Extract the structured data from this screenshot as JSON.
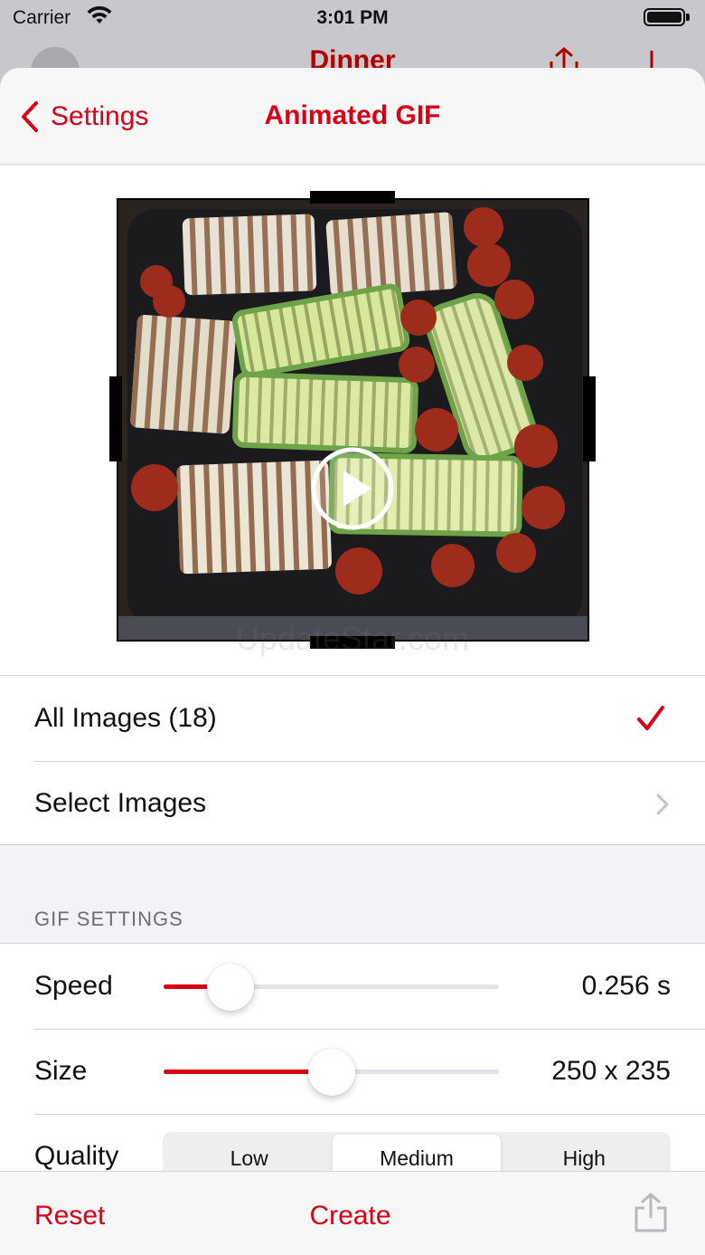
{
  "status_bar": {
    "carrier": "Carrier",
    "time": "3:01 PM"
  },
  "background_nav": {
    "title": "Dinner"
  },
  "navbar": {
    "back_label": "Settings",
    "title": "Animated GIF"
  },
  "preview": {
    "watermark": "UpdateStar.com",
    "play_icon": "play-icon"
  },
  "image_selection": [
    {
      "label": "All Images (18)",
      "accessory": "checkmark-icon",
      "selected": true
    },
    {
      "label": "Select Images",
      "accessory": "chevron-right-icon",
      "selected": false
    }
  ],
  "gif_settings": {
    "header": "GIF SETTINGS",
    "speed": {
      "label": "Speed",
      "value": "0.256 s",
      "level": 0.2
    },
    "size": {
      "label": "Size",
      "value": "250 x 235",
      "level": 0.5
    },
    "quality": {
      "label": "Quality",
      "options": [
        "Low",
        "Medium",
        "High"
      ],
      "selected": "Medium"
    }
  },
  "toolbar": {
    "reset_label": "Reset",
    "create_label": "Create",
    "share_icon": "share-icon"
  },
  "colors": {
    "accent": "#d70015",
    "background": "#f2f2f7",
    "separator": "#d1d1d6"
  }
}
